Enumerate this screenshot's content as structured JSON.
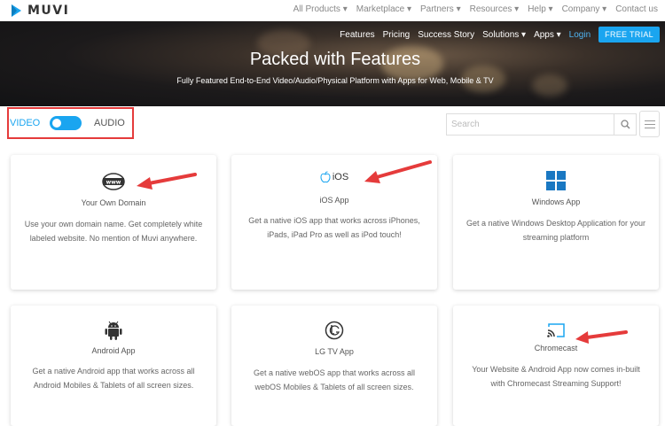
{
  "brand": {
    "name": "MUVI"
  },
  "top_nav": [
    "All Products ▾",
    "Marketplace ▾",
    "Partners ▾",
    "Resources ▾",
    "Help ▾",
    "Company ▾",
    "Contact us"
  ],
  "hero_nav": {
    "features": "Features",
    "pricing": "Pricing",
    "success": "Success Story",
    "solutions": "Solutions ▾",
    "apps": "Apps ▾",
    "login": "Login",
    "trial": "FREE TRIAL"
  },
  "hero": {
    "title": "Packed with Features",
    "subtitle": "Fully Featured End-to-End Video/Audio/Physical Platform with Apps for Web, Mobile & TV"
  },
  "filter": {
    "video": "VIDEO",
    "audio": "AUDIO",
    "toggle_on": true
  },
  "search": {
    "placeholder": "Search"
  },
  "cards": [
    {
      "title": "Your Own Domain",
      "desc": "Use your own domain name. Get completely white labeled website. No mention of Muvi anywhere.",
      "icon": "www-globe-icon"
    },
    {
      "title": "iOS App",
      "icon_text": "iOS",
      "desc": "Get a native iOS app that works across iPhones, iPads, iPad Pro as well as iPod touch!",
      "icon": "apple-icon"
    },
    {
      "title": "Windows App",
      "desc": "Get a native Windows Desktop Application for your streaming platform",
      "icon": "windows-icon"
    },
    {
      "title": "Android App",
      "desc": "Get a native Android app that works across all Android Mobiles & Tablets of all screen sizes.",
      "icon": "android-icon"
    },
    {
      "title": "LG TV App",
      "desc": "Get a native webOS app that works across all webOS Mobiles & Tablets of all screen sizes.",
      "icon": "lg-icon"
    },
    {
      "title": "Chromecast",
      "desc": "Your Website & Android App now comes in-built with Chromecast Streaming Support!",
      "icon": "cast-icon"
    }
  ],
  "colors": {
    "accent": "#1aa5f0",
    "annotation": "#e53b3b"
  }
}
